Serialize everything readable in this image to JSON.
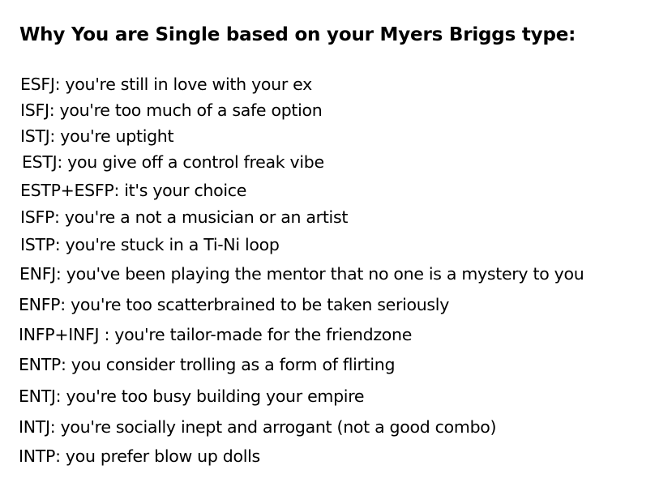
{
  "title": "Why You are Single based on your Myers Briggs type:",
  "entries": [
    "ESFJ: you're still in love with your ex",
    "ISFJ: you're too much of a safe option",
    "ISTJ: you're uptight",
    "ESTJ: you give off a control freak vibe",
    "ESTP+ESFP: it's your choice",
    "ISFP: you're a not a musician or an artist",
    "ISTP:  you're stuck in a Ti-Ni loop",
    "ENFJ:  you've been playing the mentor that no one is a mystery to you",
    "ENFP: you're too scatterbrained to be taken seriously",
    "INFP+INFJ : you're tailor-made for the friendzone",
    "ENTP: you consider trolling as a form of flirting",
    "ENTJ: you're too busy building your empire",
    "INTJ: you're socially inept and arrogant (not a good combo)",
    "INTP: you prefer blow up dolls"
  ]
}
